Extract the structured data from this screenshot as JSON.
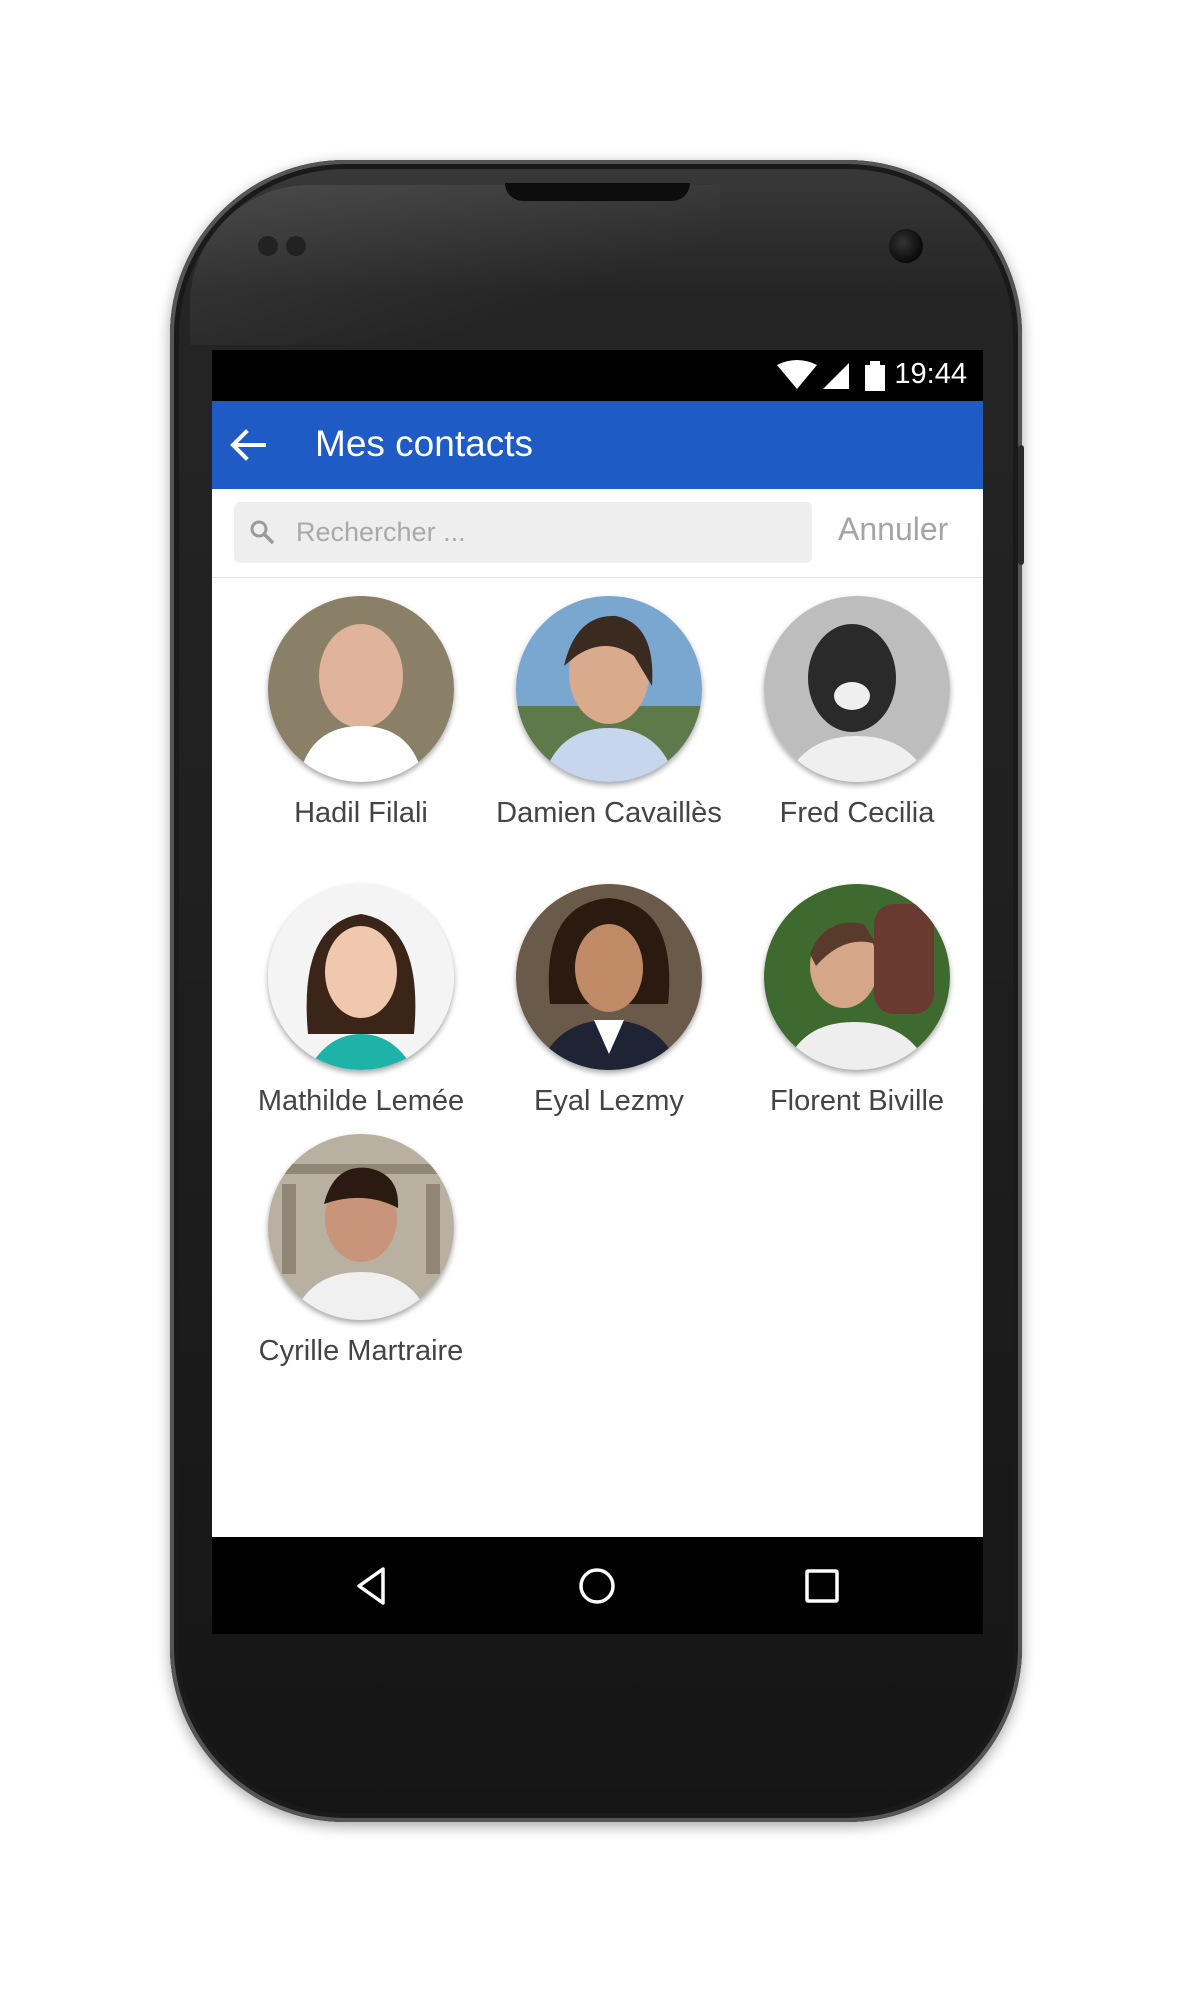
{
  "status_bar": {
    "time": "19:44",
    "icons": [
      "wifi-icon",
      "signal-icon",
      "battery-icon"
    ]
  },
  "app_bar": {
    "title": "Mes contacts",
    "back_icon": "arrow-left-icon",
    "color": "#1f5bc4"
  },
  "search": {
    "placeholder": "Rechercher ...",
    "value": "",
    "cancel_label": "Annuler"
  },
  "contacts": [
    {
      "name": "Hadil Filali",
      "avatar_tones": [
        "#8a8068",
        "#e0b49a",
        "#ffffff"
      ]
    },
    {
      "name": "Damien Cavaillès",
      "avatar_tones": [
        "#7aa7cf",
        "#3a2a20",
        "#c7d6ec"
      ]
    },
    {
      "name": "Fred Cecilia",
      "avatar_tones": [
        "#bdbdbd",
        "#2a2a2a",
        "#efefef"
      ]
    },
    {
      "name": "Mathilde Lemée",
      "avatar_tones": [
        "#f4f4f4",
        "#3b2418",
        "#1fb2a8"
      ]
    },
    {
      "name": "Eyal Lezmy",
      "avatar_tones": [
        "#6a5a4a",
        "#2a1a10",
        "#1e2433"
      ]
    },
    {
      "name": "Florent Biville",
      "avatar_tones": [
        "#3f6a2f",
        "#5a3a2a",
        "#eeeeee"
      ]
    },
    {
      "name": "Cyrille Martraire",
      "avatar_tones": [
        "#b8b0a0",
        "#2a1a12",
        "#f0f0f0"
      ]
    }
  ],
  "nav": {
    "icons": [
      "back-triangle-icon",
      "home-circle-icon",
      "recents-square-icon"
    ]
  }
}
